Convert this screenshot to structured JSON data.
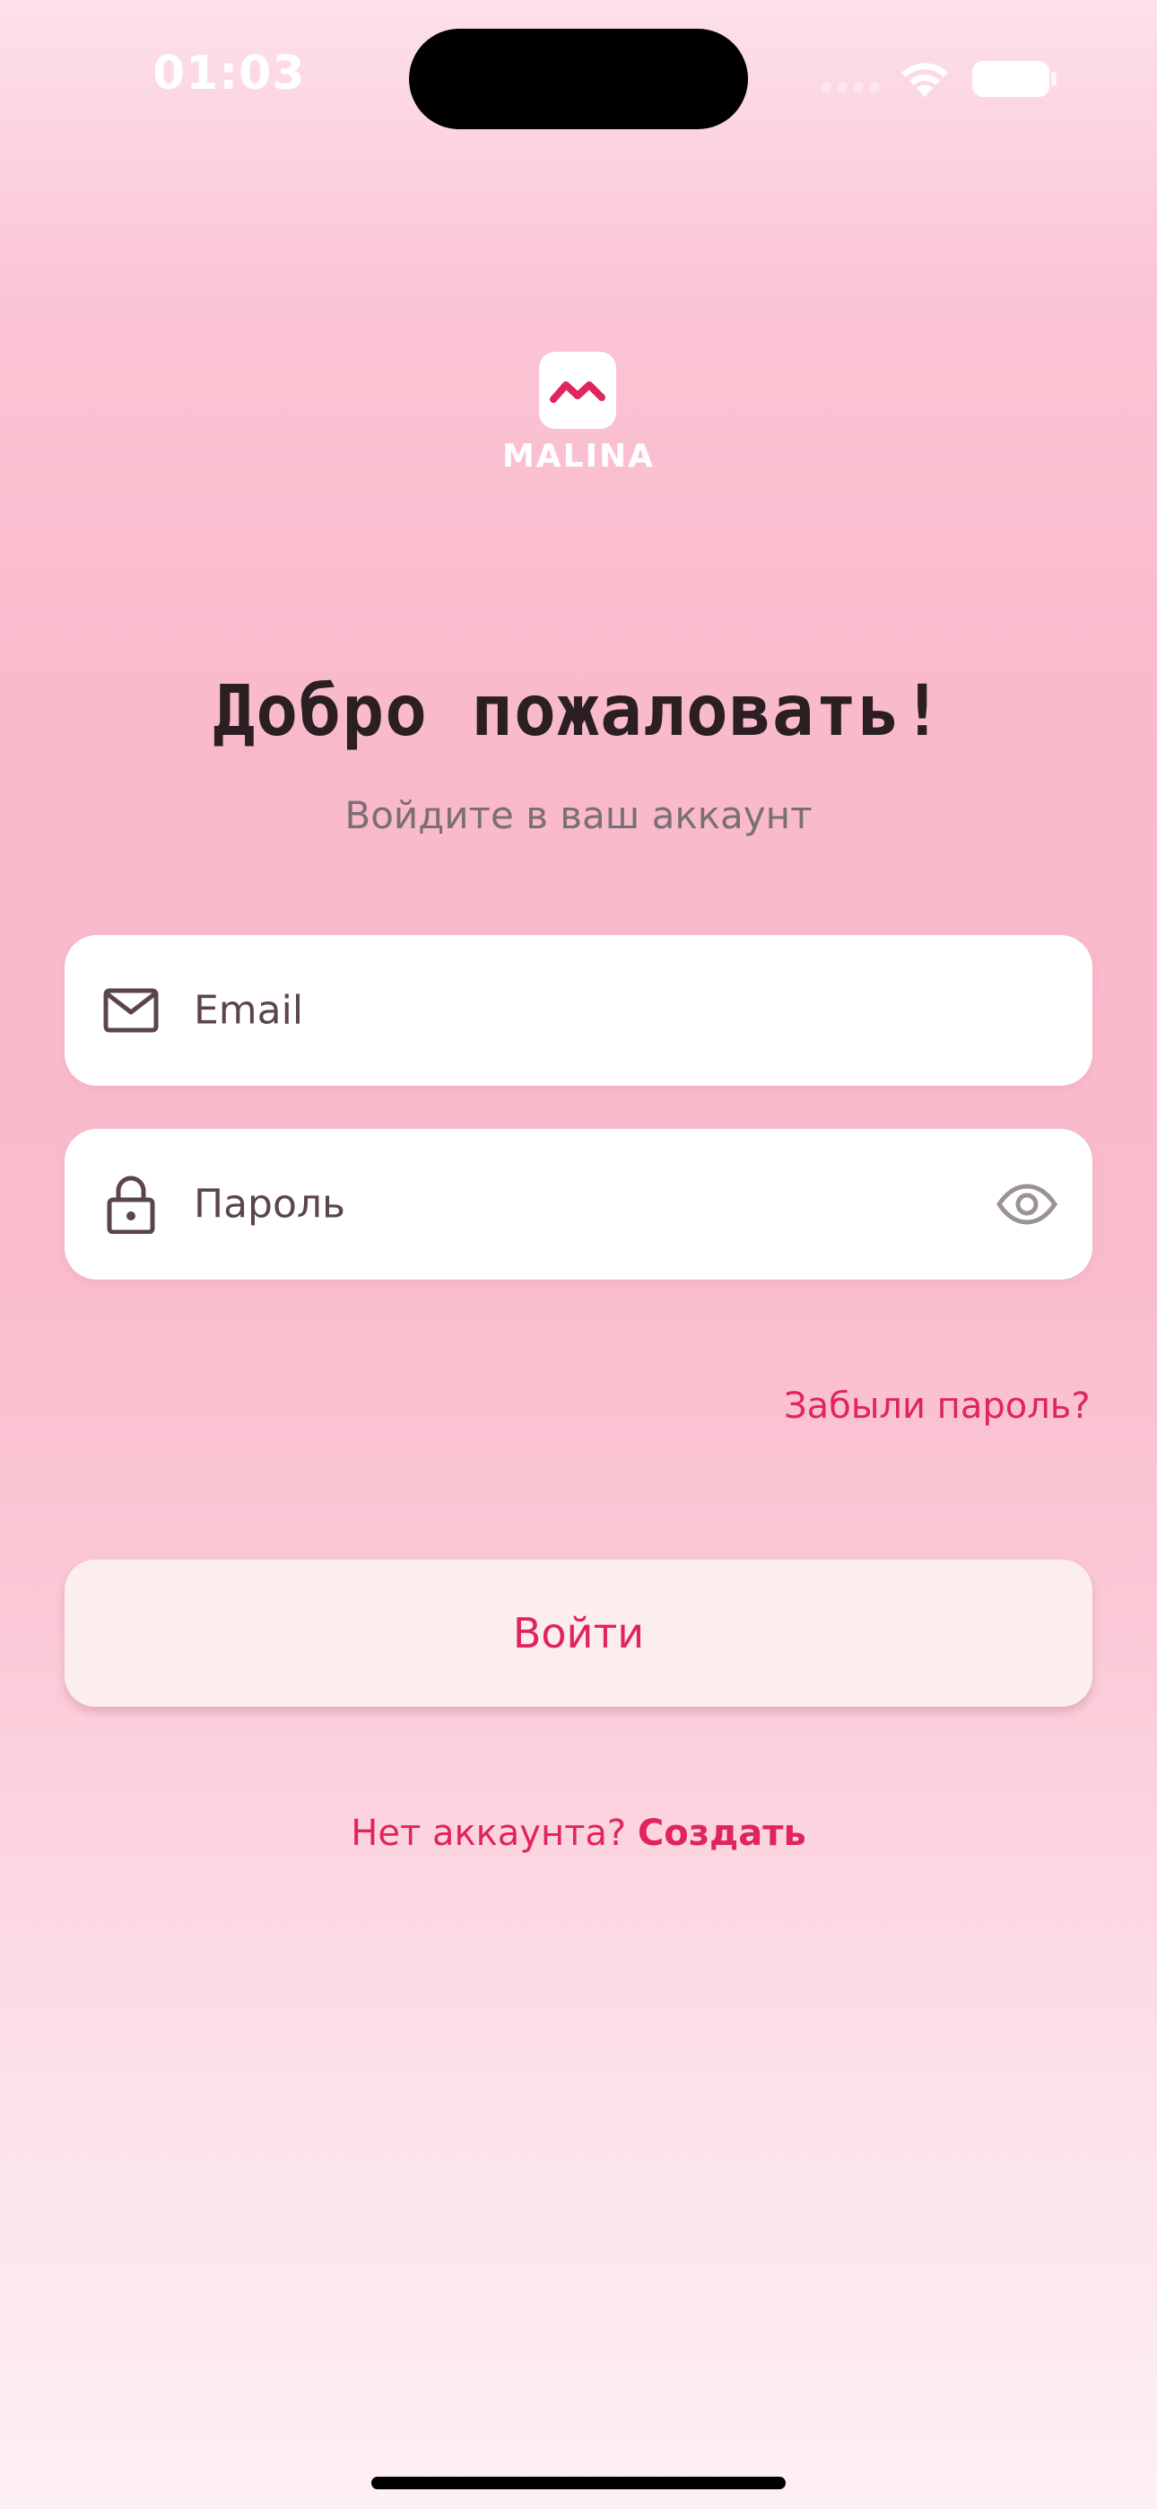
{
  "status_bar": {
    "time": "01:03"
  },
  "brand": {
    "logo_icon": "malina-wave-icon",
    "name": "MALINA",
    "accent_color": "#e0245e"
  },
  "header": {
    "title": "Добро пожаловать!",
    "subtitle": "Войдите в ваш аккаунт"
  },
  "form": {
    "email": {
      "placeholder": "Email",
      "value": "",
      "icon": "mail-icon"
    },
    "password": {
      "placeholder": "Пароль",
      "value": "",
      "icon": "lock-icon",
      "toggle_icon": "eye-icon"
    },
    "forgot_label": "Забыли пароль?",
    "login_label": "Войти"
  },
  "signup": {
    "prompt": "Нет аккаунта?",
    "link_label": "Создать"
  }
}
